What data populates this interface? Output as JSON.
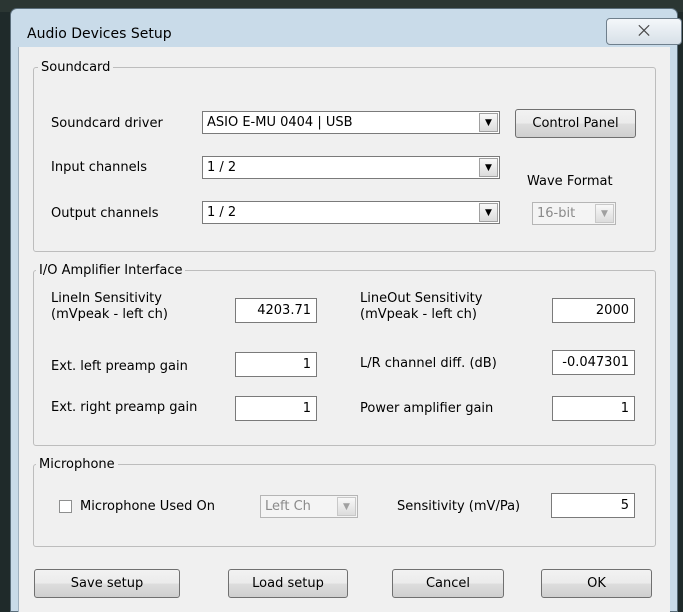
{
  "window": {
    "title": "Audio Devices Setup",
    "close_glyph": "⨉"
  },
  "soundcard": {
    "group_label": "Soundcard",
    "driver_label": "Soundcard driver",
    "driver_value": "ASIO E-MU 0404 | USB",
    "control_panel_label": "Control Panel",
    "input_label": "Input channels",
    "input_value": "1 / 2",
    "output_label": "Output channels",
    "output_value": "1 / 2",
    "wave_format_label": "Wave Format",
    "wave_format_value": "16-bit"
  },
  "io": {
    "group_label": "I/O Amplifier Interface",
    "linein_label_1": "LineIn Sensitivity",
    "linein_label_2": "(mVpeak - left ch)",
    "linein_value": "4203.71",
    "lineout_label_1": "LineOut Sensitivity",
    "lineout_label_2": "(mVpeak - left ch)",
    "lineout_value": "2000",
    "left_preamp_label": "Ext. left preamp gain",
    "left_preamp_value": "1",
    "lr_diff_label": "L/R channel diff. (dB)",
    "lr_diff_value": "-0.047301",
    "right_preamp_label": "Ext. right preamp gain",
    "right_preamp_value": "1",
    "power_amp_label": "Power amplifier gain",
    "power_amp_value": "1"
  },
  "microphone": {
    "group_label": "Microphone",
    "used_on_label": "Microphone Used On",
    "used_on_checked": false,
    "channel_value": "Left Ch",
    "sensitivity_label": "Sensitivity (mV/Pa)",
    "sensitivity_value": "5"
  },
  "buttons": {
    "save": "Save setup",
    "load": "Load setup",
    "cancel": "Cancel",
    "ok": "OK"
  },
  "icons": {
    "dropdown": "chevron-down-icon",
    "close": "close-icon"
  }
}
